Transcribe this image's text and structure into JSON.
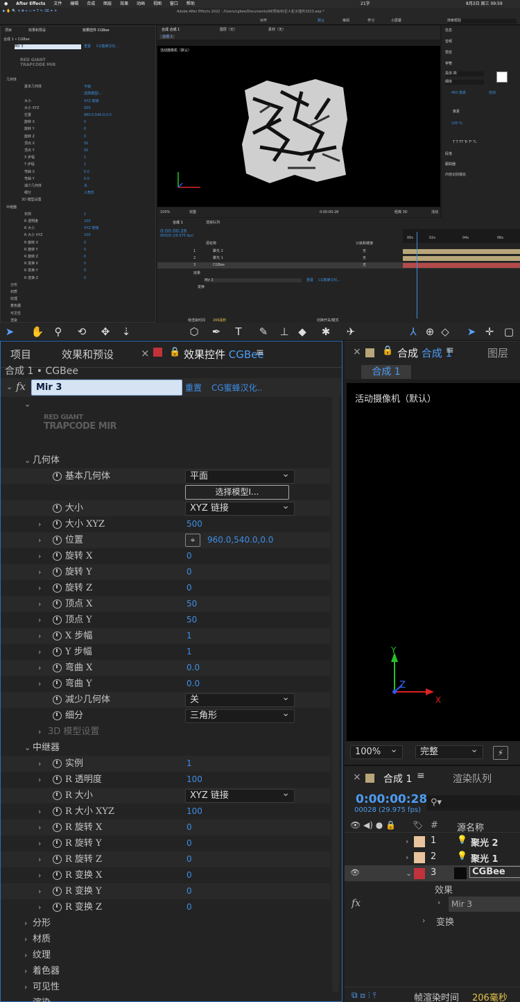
{
  "top_screenshot": {
    "menubar": {
      "app": "After Effects",
      "items": [
        "文件",
        "编辑",
        "合成",
        "图层",
        "效果",
        "动画",
        "视图",
        "窗口",
        "帮助"
      ],
      "status": "21字",
      "datetime": "8月2日 周三 09:59"
    },
    "window_title": "Adobe After Effects 2022 - /Users/cgbee/Documents/AE项目/红巨人粒子插件2023.aep *",
    "toolbar_right": {
      "workspace_default": "默认",
      "review": "审阅",
      "learn": "学习",
      "small_screen": "小屏幕",
      "search": "搜索帮助",
      "align": "对齐"
    },
    "left_tabs": [
      "项目",
      "效果和预设",
      "效果控件 CGBee"
    ],
    "breadcrumb": "合成 1 • CGBee",
    "effect": {
      "name": "Mir 3",
      "reset": "重置",
      "link": "CG蜜蜂汉化..."
    },
    "right_panel_items": [
      "信息",
      "音频",
      "预览",
      "字符",
      "段落",
      "跟踪器",
      "内容识别填充"
    ],
    "char_font": "黑体-简",
    "char_style": "细体",
    "char_size": "400 像素",
    "char_auto": "自动",
    "char_scale": "100 %",
    "char_pixels": "像素",
    "comp_tabs": [
      "合成 合成 1",
      "图层（无）",
      "素材（无）"
    ],
    "comp_sub_tab": "合成 1",
    "camera": "活动摄像机（默认）",
    "viewer_zoom": "100%",
    "viewer_quality": "完整",
    "viewer_time": "0:00:00:28",
    "viewer_renderer": "经典 3D",
    "viewer_camera_menu": "活动",
    "timeline_tabs": [
      "合成 1",
      "渲染队列"
    ],
    "tl_time": "0:00:00:28",
    "tl_frames": "00028 (29.975 fps)",
    "tl_headers": [
      "源名称",
      "父级和链接"
    ],
    "tl_layers": [
      {
        "num": "1",
        "name": "聚光 2",
        "parent": "无"
      },
      {
        "num": "2",
        "name": "聚光 1",
        "parent": "无"
      },
      {
        "num": "3",
        "name": "CGBee",
        "parent": "无"
      }
    ],
    "tl_sub": [
      "效果",
      "Mir 3",
      "变换"
    ],
    "tl_sub_actions": [
      "重置",
      "CG蜜蜂汉化..."
    ],
    "tl_ruler": [
      "00s",
      "02s",
      "04s",
      "06s"
    ],
    "tl_footer": "帧渲染时间",
    "tl_footer_value": "206毫秒",
    "tl_switch": "切换开关/模式"
  },
  "bottom": {
    "tabs": {
      "project": "项目",
      "effects_presets": "效果和预设",
      "effect_controls": "效果控件",
      "layer_name": "CGBee"
    },
    "breadcrumb": "合成 1 • CGBee",
    "effect_name": "Mir 3",
    "reset": "重置",
    "cgbee_link": "CG蜜蜂汉化..",
    "logo_line1": "RED GIANT",
    "logo_line2": "TRAPCODE MIR",
    "groups": {
      "geometry": "几何体",
      "repeater": "中继器"
    },
    "rows": [
      {
        "label": "基本几何体",
        "type": "dropdown",
        "value": "平面"
      },
      {
        "label": "",
        "type": "button",
        "value": "选择模型I..."
      },
      {
        "label": "大小",
        "type": "dropdown",
        "value": "XYZ 链接"
      },
      {
        "label": "大小 XYZ",
        "type": "value",
        "value": "500"
      },
      {
        "label": "位置",
        "type": "position",
        "value": "960.0,540.0,0.0"
      },
      {
        "label": "旋转 X",
        "type": "value",
        "value": "0"
      },
      {
        "label": "旋转 Y",
        "type": "value",
        "value": "0"
      },
      {
        "label": "旋转 Z",
        "type": "value",
        "value": "0"
      },
      {
        "label": "顶点 X",
        "type": "value",
        "value": "50"
      },
      {
        "label": "顶点 Y",
        "type": "value",
        "value": "50"
      },
      {
        "label": "X 步幅",
        "type": "value",
        "value": "1"
      },
      {
        "label": "Y 步幅",
        "type": "value",
        "value": "1"
      },
      {
        "label": "弯曲 X",
        "type": "value",
        "value": "0.0"
      },
      {
        "label": "弯曲 Y",
        "type": "value",
        "value": "0.0"
      },
      {
        "label": "减少几何体",
        "type": "dropdown",
        "value": "关"
      },
      {
        "label": "细分",
        "type": "dropdown",
        "value": "三角形"
      }
    ],
    "model_settings": "3D 模型设置",
    "repeater_rows": [
      {
        "label": "实例",
        "type": "value",
        "value": "1"
      },
      {
        "label": "R 透明度",
        "type": "value",
        "value": "100"
      },
      {
        "label": "R 大小",
        "type": "dropdown",
        "value": "XYZ 链接"
      },
      {
        "label": "R 大小 XYZ",
        "type": "value",
        "value": "100"
      },
      {
        "label": "R 旋转 X",
        "type": "value",
        "value": "0"
      },
      {
        "label": "R 旋转 Y",
        "type": "value",
        "value": "0"
      },
      {
        "label": "R 旋转 Z",
        "type": "value",
        "value": "0"
      },
      {
        "label": "R 变换 X",
        "type": "value",
        "value": "0"
      },
      {
        "label": "R 变换 Y",
        "type": "value",
        "value": "0"
      },
      {
        "label": "R 变换 Z",
        "type": "value",
        "value": "0"
      }
    ],
    "collapsed_groups": [
      "分形",
      "材质",
      "纹理",
      "着色器",
      "可见性",
      "渲染"
    ],
    "right": {
      "comp_tab": "合成",
      "comp_name": "合成 1",
      "layer_tab": "图层",
      "sub_tab": "合成 1",
      "camera": "活动摄像机（默认）",
      "zoom": "100%",
      "quality": "完整",
      "timeline_tab": "合成 1",
      "render_queue": "渲染队列",
      "timecode": "0:00:00:28",
      "frames": "00028 (29.975 fps)",
      "hash": "#",
      "source_name": "源名称",
      "layers": [
        {
          "num": "1",
          "name": "聚光 2"
        },
        {
          "num": "2",
          "name": "聚光 1"
        },
        {
          "num": "3",
          "name": "CGBee"
        }
      ],
      "effects": "效果",
      "mir": "Mir 3",
      "transform": "变换",
      "footer_label": "帧渲染时间",
      "footer_value": "206毫秒"
    },
    "axis": {
      "x": "X",
      "y": "Y",
      "z": "Z"
    }
  }
}
